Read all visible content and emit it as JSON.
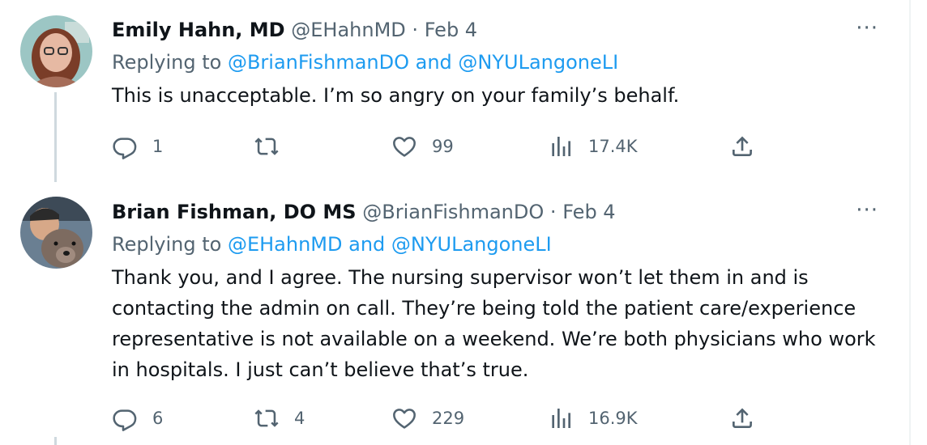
{
  "tweets": [
    {
      "author_name": "Emily Hahn, MD",
      "handle": "@EHahnMD",
      "separator": "·",
      "date": "Feb 4",
      "replying_label": "Replying to",
      "reply_mention_1": "@BrianFishmanDO",
      "reply_and": "and",
      "reply_mention_2": "@NYULangoneLI",
      "text": "This is unacceptable. I’m so angry on your family’s behalf.",
      "more": "···",
      "reply_count": "1",
      "retweet_count": "",
      "like_count": "99",
      "view_count": "17.4K"
    },
    {
      "author_name": "Brian Fishman, DO MS",
      "handle": "@BrianFishmanDO",
      "separator": "·",
      "date": "Feb 4",
      "replying_label": "Replying to",
      "reply_mention_1": "@EHahnMD",
      "reply_and": "and",
      "reply_mention_2": "@NYULangoneLI",
      "text": "Thank you, and I agree. The nursing supervisor won’t let them in and is contacting the admin on call. They’re being told the patient care/experience representative is not available on a weekend. We’re both physicians who work in hospitals. I just can’t believe that’s true.",
      "more": "···",
      "reply_count": "6",
      "retweet_count": "4",
      "like_count": "229",
      "view_count": "16.9K"
    }
  ],
  "icons": {
    "reply": "reply-icon",
    "retweet": "retweet-icon",
    "like": "heart-icon",
    "views": "views-icon",
    "share": "share-icon",
    "more": "more-icon"
  },
  "colors": {
    "text": "#0f1419",
    "secondary": "#536471",
    "link": "#1d9bf0",
    "thread_line": "#cfd9de"
  }
}
